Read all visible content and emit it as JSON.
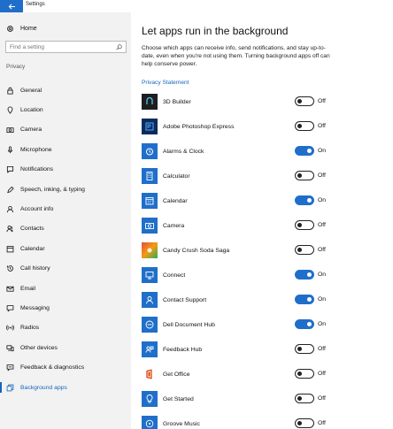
{
  "window": {
    "title": "Settings"
  },
  "sidebar": {
    "home_label": "Home",
    "search_placeholder": "Find a setting",
    "section_label": "Privacy",
    "items": [
      {
        "label": "General",
        "icon": "lock-icon",
        "active": false
      },
      {
        "label": "Location",
        "icon": "location-icon",
        "active": false
      },
      {
        "label": "Camera",
        "icon": "camera-icon",
        "active": false
      },
      {
        "label": "Microphone",
        "icon": "microphone-icon",
        "active": false
      },
      {
        "label": "Notifications",
        "icon": "notifications-icon",
        "active": false
      },
      {
        "label": "Speech, inking, & typing",
        "icon": "speech-icon",
        "active": false
      },
      {
        "label": "Account info",
        "icon": "account-icon",
        "active": false
      },
      {
        "label": "Contacts",
        "icon": "contacts-icon",
        "active": false
      },
      {
        "label": "Calendar",
        "icon": "calendar-icon",
        "active": false
      },
      {
        "label": "Call history",
        "icon": "call-history-icon",
        "active": false
      },
      {
        "label": "Email",
        "icon": "email-icon",
        "active": false
      },
      {
        "label": "Messaging",
        "icon": "messaging-icon",
        "active": false
      },
      {
        "label": "Radios",
        "icon": "radios-icon",
        "active": false
      },
      {
        "label": "Other devices",
        "icon": "other-devices-icon",
        "active": false
      },
      {
        "label": "Feedback & diagnostics",
        "icon": "feedback-icon",
        "active": false
      },
      {
        "label": "Background apps",
        "icon": "background-apps-icon",
        "active": true
      }
    ]
  },
  "main": {
    "title": "Let apps run in the background",
    "description": "Choose which apps can receive info, send notifications, and stay up-to-date, even when you're not using them. Turning background apps off can help conserve power.",
    "privacy_link": "Privacy Statement",
    "apps": [
      {
        "name": "3D Builder",
        "state": "Off",
        "icon": "3d-builder-icon",
        "icon_color": "#1e1e1e"
      },
      {
        "name": "Adobe Photoshop Express",
        "state": "Off",
        "icon": "photoshop-express-icon",
        "icon_color": "#0b2c5c"
      },
      {
        "name": "Alarms & Clock",
        "state": "On",
        "icon": "alarm-clock-icon",
        "icon_color": "#1f6fca"
      },
      {
        "name": "Calculator",
        "state": "Off",
        "icon": "calculator-icon",
        "icon_color": "#1f6fca"
      },
      {
        "name": "Calendar",
        "state": "On",
        "icon": "calendar-app-icon",
        "icon_color": "#1f6fca"
      },
      {
        "name": "Camera",
        "state": "Off",
        "icon": "camera-app-icon",
        "icon_color": "#1f6fca"
      },
      {
        "name": "Candy Crush Soda Saga",
        "state": "Off",
        "icon": "candy-crush-icon",
        "icon_color": "#c0392b"
      },
      {
        "name": "Connect",
        "state": "On",
        "icon": "connect-icon",
        "icon_color": "#1f6fca"
      },
      {
        "name": "Contact Support",
        "state": "On",
        "icon": "contact-support-icon",
        "icon_color": "#1f6fca"
      },
      {
        "name": "Dell Document Hub",
        "state": "On",
        "icon": "dell-document-hub-icon",
        "icon_color": "#1f6fca"
      },
      {
        "name": "Feedback Hub",
        "state": "Off",
        "icon": "feedback-hub-icon",
        "icon_color": "#1f6fca"
      },
      {
        "name": "Get Office",
        "state": "Off",
        "icon": "get-office-icon",
        "icon_color": "#d83b01"
      },
      {
        "name": "Get Started",
        "state": "Off",
        "icon": "get-started-icon",
        "icon_color": "#1f6fca"
      },
      {
        "name": "Groove Music",
        "state": "Off",
        "icon": "groove-music-icon",
        "icon_color": "#1f6fca"
      }
    ]
  },
  "colors": {
    "accent": "#1f6fca",
    "sidebar_bg": "#f2f2f2",
    "link": "#1565c0"
  }
}
